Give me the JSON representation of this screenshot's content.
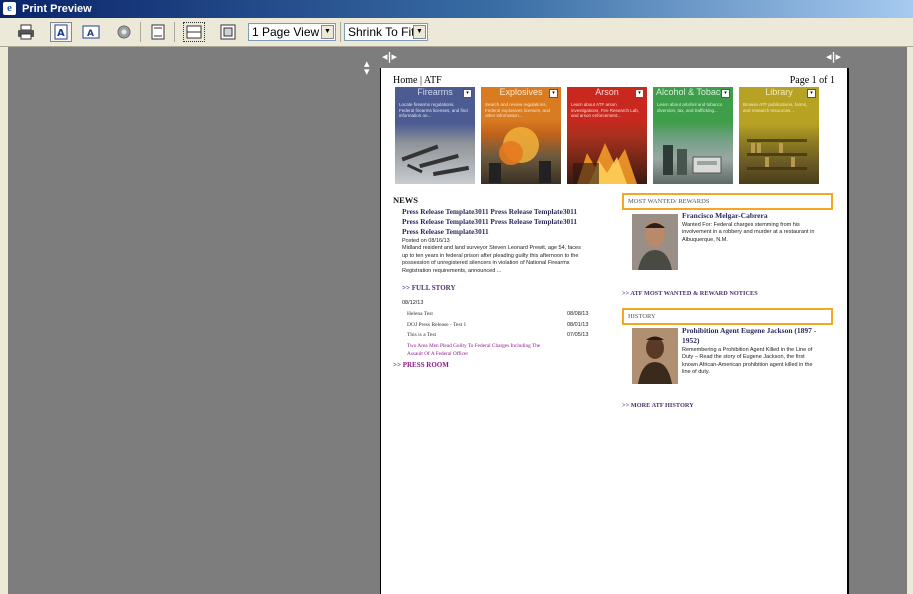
{
  "window": {
    "title": "Print Preview"
  },
  "toolbar": {
    "print_icon": "printer-icon",
    "portrait_icon": "portrait-icon",
    "landscape_icon": "landscape-icon",
    "page_setup_icon": "page-setup-icon",
    "header_footer_icon": "header-footer-icon",
    "full_width_icon": "full-width-icon",
    "full_page_icon": "full-page-icon",
    "page_view_value": "1 Page View",
    "shrink_value": "Shrink To Fit"
  },
  "page": {
    "header_left": "Home | ATF",
    "header_right": "Page 1 of 1",
    "banners": [
      {
        "title": "Firearms",
        "desc": "Locate firearms regulations, Federal firearms licenses, and find information on...",
        "color": "#4c5c93",
        "photo": "#8f9499"
      },
      {
        "title": "Explosives",
        "desc": "Search and review regulations, Federal explosives licenses, and other information...",
        "color": "#d97b21",
        "photo": "#6b5a40"
      },
      {
        "title": "Arson",
        "desc": "Learn about ATF arson investigations, Fire Research Lab, and arson enforcement...",
        "color": "#c8281e",
        "photo": "#7a2818"
      },
      {
        "title": "Alcohol & Tobacco",
        "desc": "Learn about alcohol and tobacco diversion, tax, and trafficking...",
        "color": "#3f9e4a",
        "photo": "#8a9a95"
      },
      {
        "title": "Library",
        "desc": "Browse ATF publications, forms, and research resources...",
        "color": "#b8a223",
        "photo": "#6b5a25"
      }
    ],
    "news": {
      "heading": "NEWS",
      "title_lines": [
        "Press Release Template3011 Press Release Template3011",
        "Press Release Template3011 Press Release Template3011",
        "Press Release Template3011"
      ],
      "posted": "Posted on 08/16/13",
      "body_lines": [
        "Midland resident and land surveyor Steven Leonard Prewit, age 54, faces",
        "up to ten years in federal prison after pleading guilty this afternoon to the",
        "possession of unregistered silencers in violation of National Firearms",
        "Registration requirements, announced ..."
      ],
      "full_story": ">> FULL STORY",
      "list_date": "08/12/13",
      "items": [
        {
          "title": "Helena Test",
          "date": "08/08/13"
        },
        {
          "title": "DOJ Press Release - Test 1",
          "date": "08/01/13"
        },
        {
          "title": "This is a Test",
          "date": "07/05/13"
        }
      ],
      "highlight_lines": [
        "Two Area Men Plead Guilty To Federal Charges Including The",
        "Assault Of A Federal Officer"
      ],
      "press_room": ">> PRESS ROOM"
    },
    "wanted": {
      "heading": "MOST WANTED/ REWARDS",
      "name": "Francisco Melgar-Cabrera",
      "desc_lines": [
        "Wanted For: Federal charges stemming from his",
        "involvement in a robbery and murder at a restaurant in",
        "Albuquerque, N.M."
      ],
      "link": ">> ATF MOST WANTED & REWARD NOTICES"
    },
    "history": {
      "heading": "HISTORY",
      "name_lines": [
        "Prohibition Agent Eugene Jackson (1897 -",
        "1952)"
      ],
      "desc_lines": [
        "Remembering a Prohibition Agent Killed in the Line of",
        "Duty – Read the story of Eugene Jackson, the first",
        "known African-American prohibition agent killed in the",
        "line of duty."
      ],
      "link": ">> MORE ATF HISTORY"
    }
  },
  "colors": {
    "accent_box": "#f5a623",
    "news_title": "#2b2b5e",
    "link": "#4e2f6b",
    "highlight": "#8b1a8b",
    "canvas": "#7d7d7d"
  }
}
